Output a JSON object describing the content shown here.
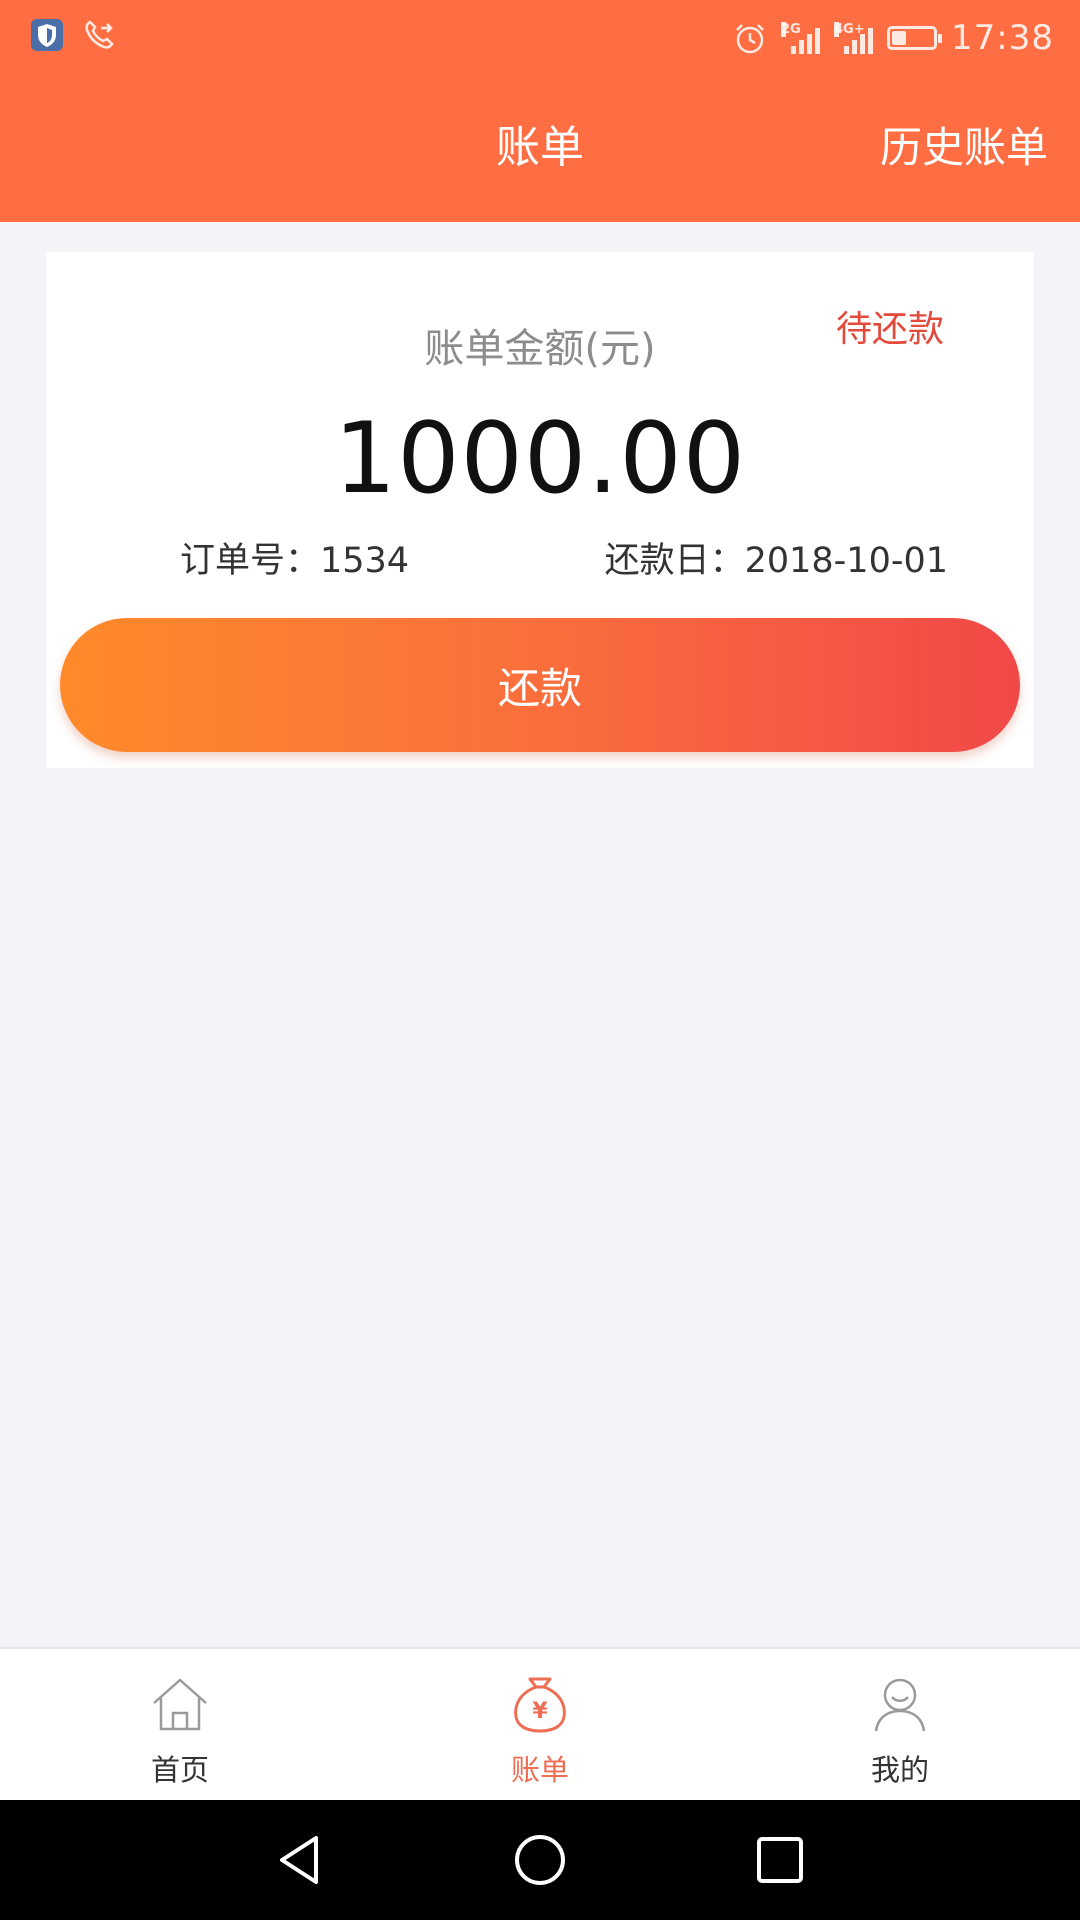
{
  "status_bar": {
    "time": "17:38",
    "sim1_label": "2G",
    "sim2_label": "4G+",
    "battery_level": 0.35,
    "icons": [
      "shield-app-icon",
      "call-forward-icon",
      "alarm-icon",
      "signal-icon",
      "battery-icon"
    ]
  },
  "nav": {
    "title": "账单",
    "history_link": "历史账单"
  },
  "bill": {
    "status": "待还款",
    "amount_label": "账单金额(元)",
    "amount": "1000.00",
    "order_no": "订单号：1534",
    "due_date": "还款日：2018-10-01",
    "pay_button": "还款"
  },
  "tabs": [
    {
      "label": "首页",
      "icon": "home-icon",
      "active": false
    },
    {
      "label": "账单",
      "icon": "money-bag-icon",
      "active": true
    },
    {
      "label": "我的",
      "icon": "user-icon",
      "active": false
    }
  ],
  "colors": {
    "header": "#ff6e43",
    "status_tag": "#e34a3b",
    "button_gradient_start": "#ff8a2a",
    "button_gradient_end": "#f14848",
    "active_tab": "#ee6e54",
    "background": "#f3f3f8"
  }
}
